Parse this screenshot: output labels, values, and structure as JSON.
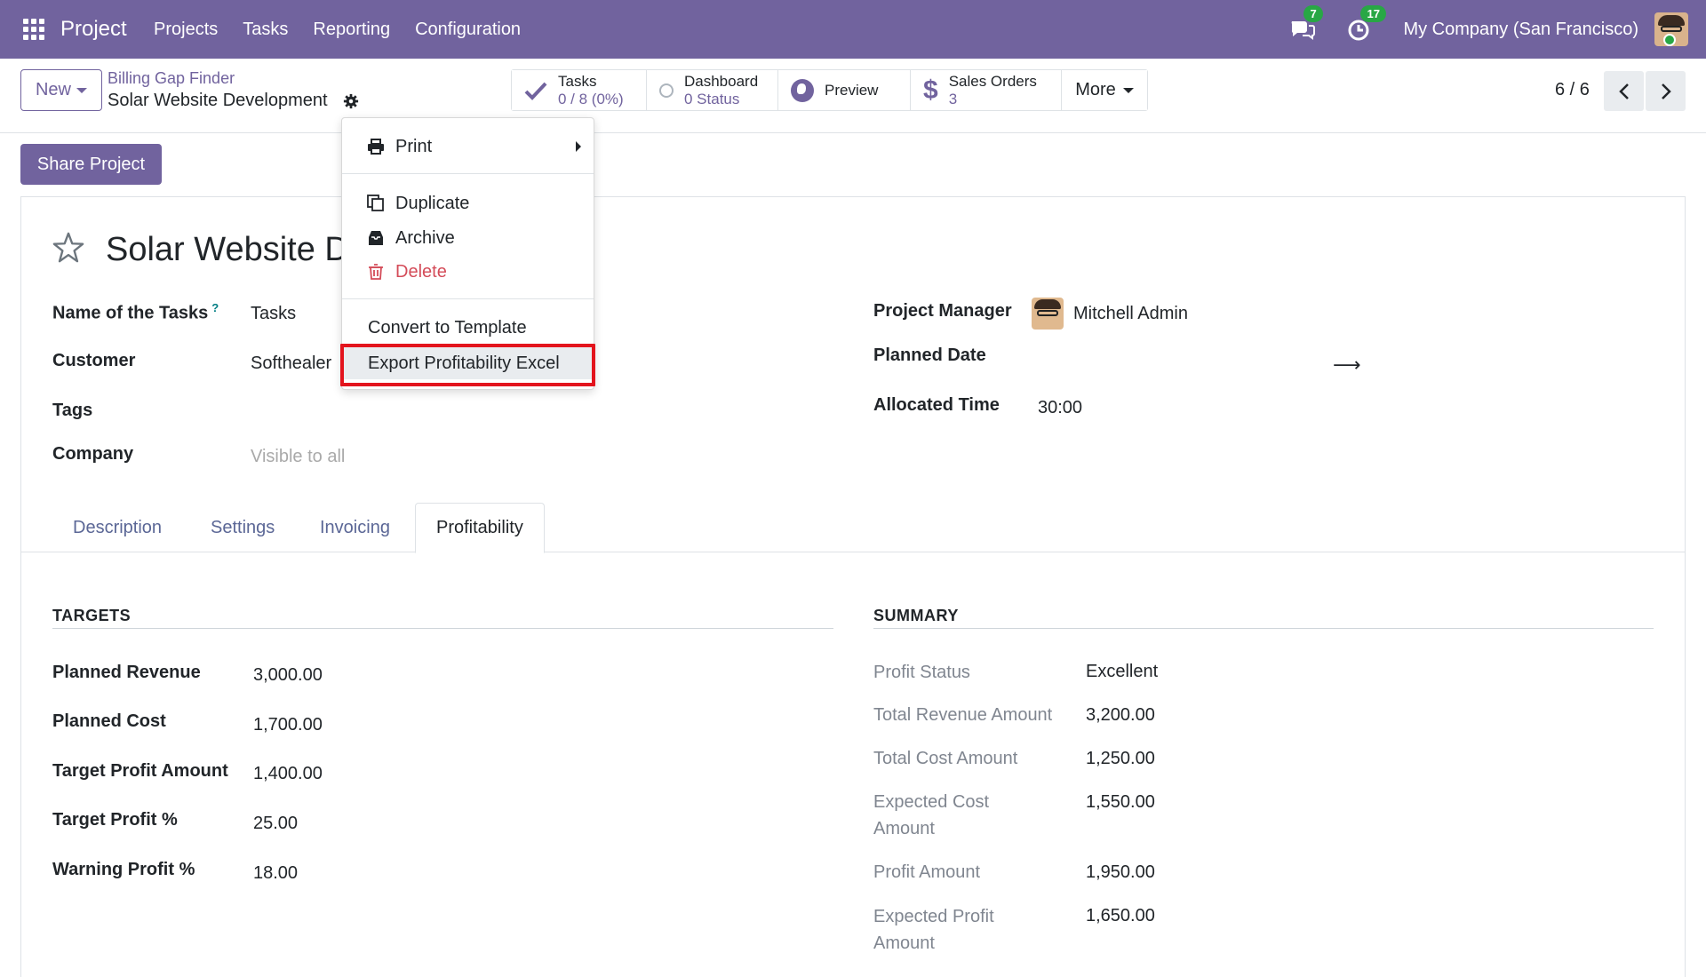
{
  "navbar": {
    "brand": "Project",
    "menu": [
      "Projects",
      "Tasks",
      "Reporting",
      "Configuration"
    ],
    "messages_count": "7",
    "activities_count": "17",
    "company": "My Company (San Francisco)"
  },
  "control_panel": {
    "new_label": "New",
    "breadcrumb_parent": "Billing Gap Finder",
    "breadcrumb_current": "Solar Website Development",
    "smart_buttons": {
      "tasks_title": "Tasks",
      "tasks_value": "0 / 8 (0%)",
      "dashboard_title": "Dashboard",
      "dashboard_value": "0 Status",
      "preview_title": "Preview",
      "sales_title": "Sales Orders",
      "sales_value": "3",
      "more_label": "More"
    },
    "pager": "6 / 6"
  },
  "share_label": "Share Project",
  "form": {
    "title": "Solar Website Development",
    "name_of_tasks_label": "Name of the Tasks",
    "name_of_tasks_help": "?",
    "name_of_tasks_value": "Tasks",
    "customer_label": "Customer",
    "customer_value": "Softhealer",
    "tags_label": "Tags",
    "company_label": "Company",
    "company_placeholder": "Visible to all",
    "project_manager_label": "Project Manager",
    "project_manager_value": "Mitchell Admin",
    "planned_date_label": "Planned Date",
    "allocated_time_label": "Allocated Time",
    "allocated_time_value": "30:00"
  },
  "tabs": [
    "Description",
    "Settings",
    "Invoicing",
    "Profitability"
  ],
  "targets": {
    "title": "TARGETS",
    "rows": [
      {
        "label": "Planned Revenue",
        "value": "3,000.00"
      },
      {
        "label": "Planned Cost",
        "value": "1,700.00"
      },
      {
        "label": "Target Profit Amount",
        "value": "1,400.00"
      },
      {
        "label": "Target Profit %",
        "value": "25.00"
      },
      {
        "label": "Warning Profit %",
        "value": "18.00"
      }
    ]
  },
  "summary": {
    "title": "SUMMARY",
    "rows": [
      {
        "label": "Profit Status",
        "value": "Excellent"
      },
      {
        "label": "Total Revenue Amount",
        "value": "3,200.00"
      },
      {
        "label": "Total Cost Amount",
        "value": "1,250.00"
      },
      {
        "label": "Expected Cost Amount",
        "value": "1,550.00"
      },
      {
        "label": "Profit Amount",
        "value": "1,950.00"
      },
      {
        "label": "Expected Profit Amount",
        "value": "1,650.00"
      }
    ]
  },
  "dropdown": {
    "print": "Print",
    "duplicate": "Duplicate",
    "archive": "Archive",
    "delete": "Delete",
    "convert_template": "Convert to Template",
    "export_excel": "Export Profitability Excel"
  },
  "colors": {
    "brand": "#71639e",
    "badge": "#28a745",
    "delete": "#d44c59",
    "highlight_frame": "#e3141d"
  }
}
